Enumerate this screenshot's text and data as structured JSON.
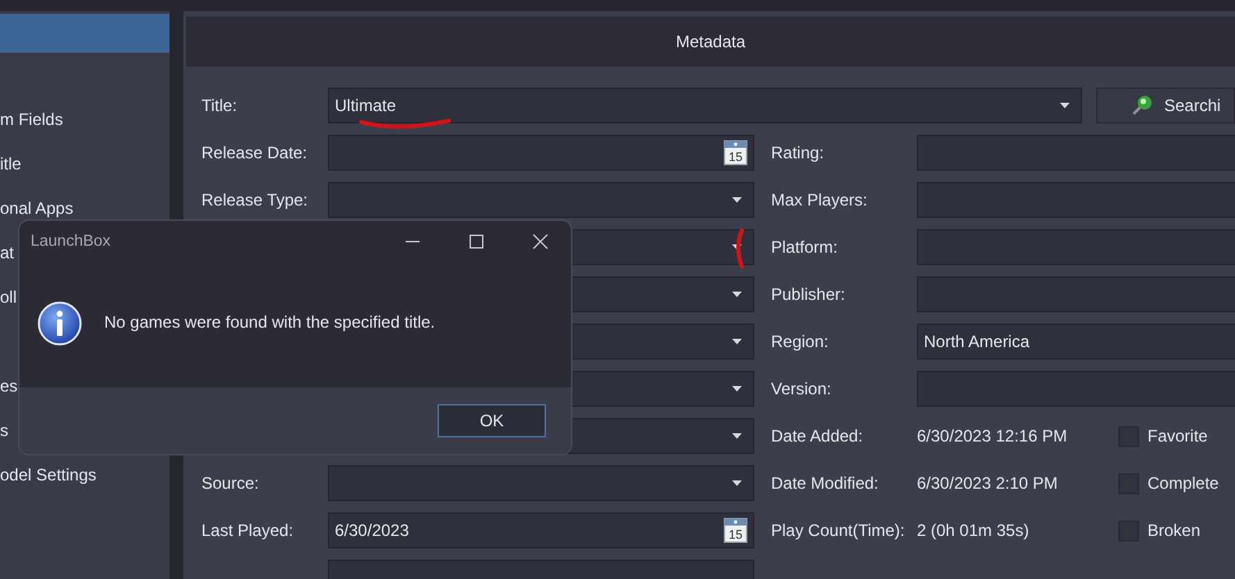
{
  "sidebar": {
    "items": [
      {
        "selected": true
      },
      {
        "label": "m Fields",
        "selected": false
      },
      {
        "label": "itle",
        "selected": false
      },
      {
        "label": "onal Apps",
        "selected": false
      },
      {
        "label": "at",
        "selected": false
      },
      {
        "label": "oll",
        "selected": false
      },
      {
        "selected": false
      },
      {
        "label": "es",
        "selected": false
      },
      {
        "label": "s",
        "selected": false
      },
      {
        "label": "odel Settings",
        "selected": false
      }
    ]
  },
  "metadata": {
    "header": "Metadata",
    "title": {
      "label": "Title:",
      "value": "Ultimate"
    },
    "search_button": "Searchi",
    "left_fields": [
      {
        "label": "Release Date:",
        "kind": "date",
        "icon_text": "15"
      },
      {
        "label": "Release Type:",
        "kind": "dropdown"
      },
      {
        "kind": "dropdown"
      },
      {
        "kind": "dropdown"
      },
      {
        "kind": "dropdown"
      },
      {
        "kind": "dropdown"
      },
      {
        "kind": "dropdown"
      },
      {
        "label": "Source:",
        "kind": "dropdown"
      },
      {
        "label": "Last Played:",
        "kind": "date",
        "value": "6/30/2023",
        "icon_text": "15"
      },
      {
        "kind": "text"
      }
    ],
    "right_fields": [
      {
        "label": "Rating:",
        "kind": "text"
      },
      {
        "label": "Max Players:",
        "kind": "text"
      },
      {
        "label": "Platform:",
        "kind": "text"
      },
      {
        "label": "Publisher:",
        "kind": "text"
      },
      {
        "label": "Region:",
        "kind": "text",
        "value": "North America"
      },
      {
        "label": "Version:",
        "kind": "text"
      },
      {
        "label": "Date Added:",
        "kind": "info",
        "value": "6/30/2023 12:16 PM",
        "checkbox": {
          "label": "Favorite",
          "checked": false
        }
      },
      {
        "label": "Date Modified:",
        "kind": "info",
        "value": "6/30/2023 2:10 PM",
        "checkbox": {
          "label": "Complete",
          "checked": false
        }
      },
      {
        "label": "Play Count(Time):",
        "kind": "info",
        "value": "2 (0h 01m 35s)",
        "checkbox": {
          "label": "Broken",
          "checked": false
        }
      }
    ]
  },
  "dialog": {
    "title": "LaunchBox",
    "message": "No games were found with the specified title.",
    "buttons": [
      "OK"
    ]
  }
}
